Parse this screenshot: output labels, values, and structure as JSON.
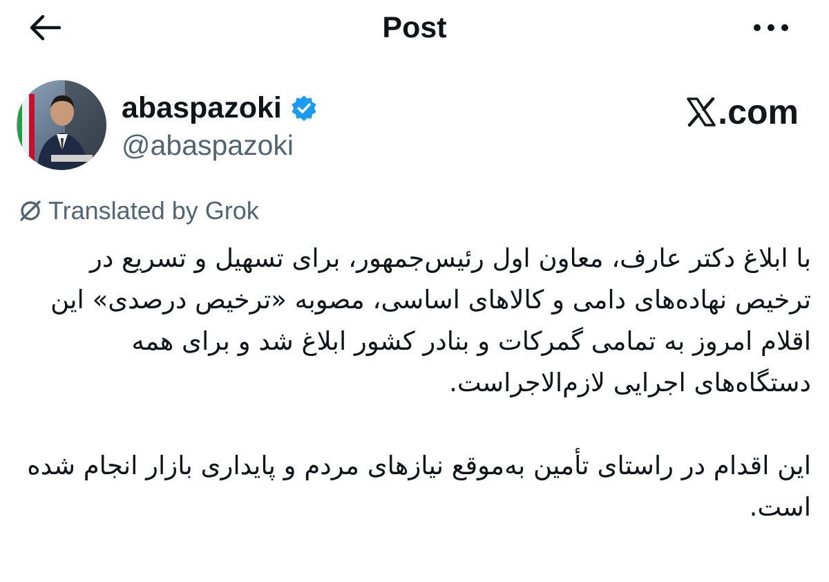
{
  "header": {
    "title": "Post",
    "back_icon": "arrow-left-icon",
    "more_icon": "more-horizontal-icon"
  },
  "author": {
    "display_name": "abaspazoki",
    "handle": "@abaspazoki",
    "verified": true,
    "verified_color": "#1d9bf0"
  },
  "watermark": {
    "text": ".com",
    "icon": "x-logo-icon"
  },
  "translation": {
    "label": "Translated by Grok",
    "icon": "translate-icon"
  },
  "post": {
    "paragraphs": [
      "با ابلاغ دکتر عارف، معاون اول رئیس‌جمهور، برای تسهیل و تسریع در ترخیص نهاده‌های دامی و کالاهای اساسی، مصوبه «ترخیص درصدی» این اقلام امروز به تمامی گمرکات و بنادر کشور ابلاغ شد و برای همه دستگاه‌های اجرایی لازم‌الاجراست.",
      "این اقدام در راستای تأمین به‌موقع نیازهای مردم و پایداری بازار انجام شده است."
    ]
  },
  "colors": {
    "text_primary": "#0f1419",
    "text_secondary": "#536471",
    "background": "#ffffff"
  }
}
